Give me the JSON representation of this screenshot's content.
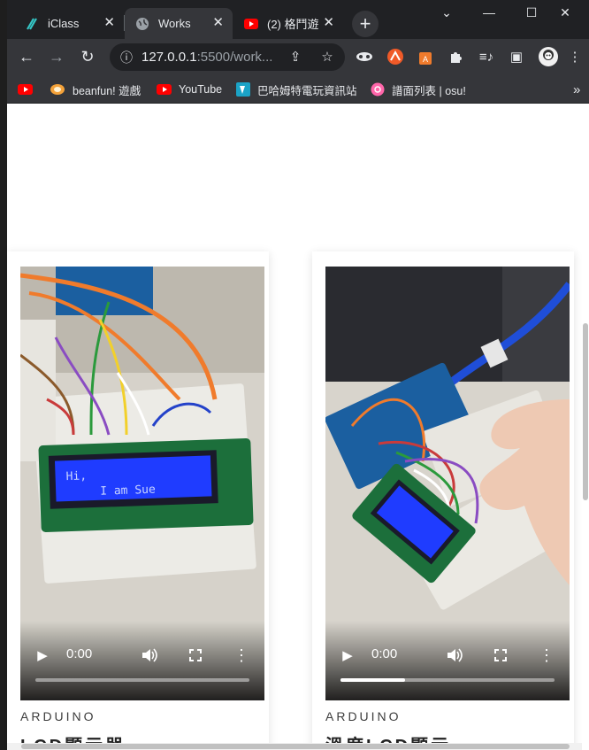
{
  "tabs": [
    {
      "label": "iClass",
      "close": "✕"
    },
    {
      "label": "Works",
      "close": "✕"
    },
    {
      "label": "(2) 格鬥遊",
      "close": "✕"
    }
  ],
  "new_tab": "+",
  "window_controls": {
    "dropdown": "⌄",
    "minimize": "—",
    "maximize": "☐",
    "close": "✕"
  },
  "toolbar": {
    "back": "←",
    "forward": "→",
    "reload": "↻",
    "info": "ⓘ",
    "url_host": "127.0.0.1",
    "url_rest": ":5500/work...",
    "share": "⇪",
    "star": "☆",
    "puzzle": "✦",
    "media": "≡♪",
    "sidebar": "▣",
    "menu": "⋮"
  },
  "bookmarks": [
    {
      "label": ""
    },
    {
      "label": "beanfun! 遊戲"
    },
    {
      "label": "YouTube"
    },
    {
      "label": "巴哈姆特電玩資訊站"
    },
    {
      "label": "譜面列表 | osu!"
    }
  ],
  "bookmarks_more": "»",
  "cards": [
    {
      "category": "ARDUINO",
      "title": "LCD顯示器",
      "time": "0:00",
      "progress": 0.0,
      "lcd_line1": "Hi,",
      "lcd_line2": "I am Sue"
    },
    {
      "category": "ARDUINO",
      "title": "溫度LCD顯示",
      "time": "0:00",
      "progress": 0.3
    }
  ],
  "icons": {
    "play": "▶",
    "volume": "🔊",
    "fullscreen": "⛶",
    "more": "⋮"
  },
  "colors": {
    "chrome_dark": "#202124",
    "chrome_tab": "#35363a",
    "lcd_blue": "#1f3cff",
    "wire_orange": "#f07b2c"
  }
}
